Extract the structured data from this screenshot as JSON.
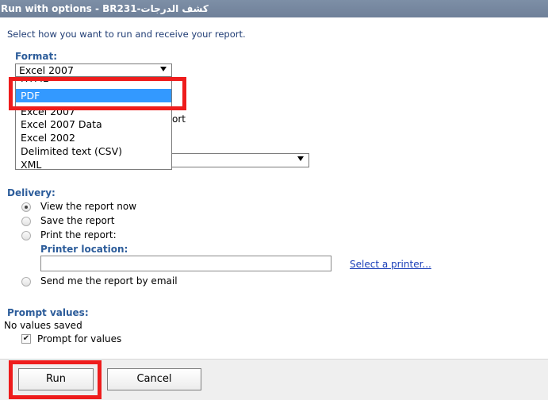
{
  "title": "Run with options - BR231-كشف الدرجات",
  "intro": "Select how you want to run and receive your report.",
  "format": {
    "label": "Format:",
    "selected": "Excel 2007",
    "options": [
      "HTML",
      "PDF",
      "Excel 2007",
      "Excel 2007 Data",
      "Excel 2002",
      "Delimited text (CSV)",
      "XML"
    ],
    "highlighted": "PDF",
    "partial_behind_text": "ort"
  },
  "delivery": {
    "label": "Delivery:",
    "options": [
      "View the report now",
      "Save the report",
      "Print the report:",
      "Send me the report by email"
    ],
    "selected": "View the report now",
    "printer_location_label": "Printer location:",
    "printer_location_value": "",
    "select_printer_link": "Select a printer..."
  },
  "prompt": {
    "label": "Prompt values:",
    "status": "No values saved",
    "checkbox_label": "Prompt for values",
    "checked": true
  },
  "buttons": {
    "run": "Run",
    "cancel": "Cancel"
  },
  "colors": {
    "highlight": "#3399ff",
    "annotation_red": "#ee1c1c",
    "section_blue": "#2c5c9a",
    "link_blue": "#1a3fb8"
  }
}
